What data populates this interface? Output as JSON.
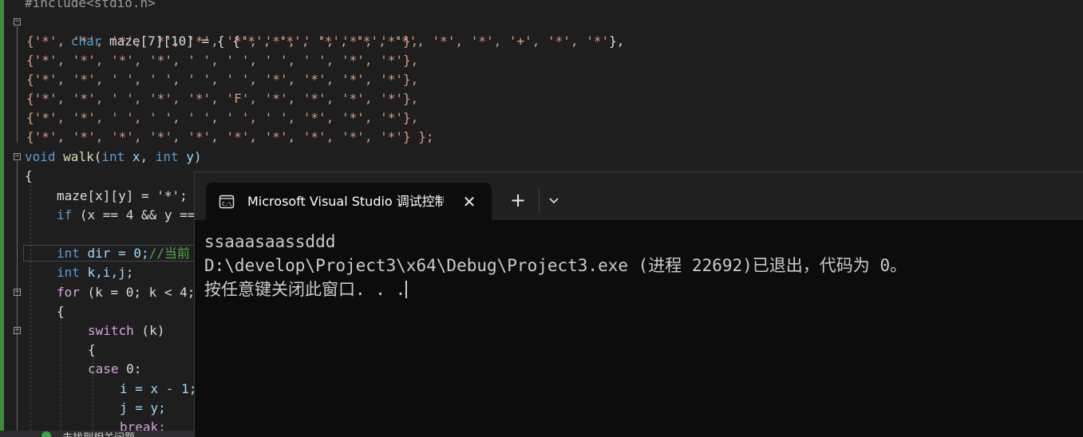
{
  "editor": {
    "include_line": "#include<stdio.h>",
    "maze_decl": "char maze[7][10] = { {'*', '*', '*', '*', '*', '*', '*', '+', '*', '*'},",
    "maze_rows": [
      "{'*', '*', '*', '*', '*', '*', '*', ' ', '*', '*'},",
      "{'*', '*', '*', '*', ' ', ' ', ' ', ' ', '*', '*'},",
      "{'*', '*', ' ', ' ', ' ', ' ', '*', '*', '*', '*'},",
      "{'*', '*', ' ', '*', '*', 'F', '*', '*', '*', '*'},",
      "{'*', '*', ' ', ' ', ' ', ' ', ' ', '*', '*', '*'},",
      "{'*', '*', '*', '*', '*', '*', '*', '*', '*', '*'} };"
    ],
    "walk_decl_kw": "void",
    "walk_decl_fn": "walk",
    "walk_decl_rest": "(",
    "walk_int1": "int",
    "walk_x": " x, ",
    "walk_int2": "int",
    "walk_y": " y)",
    "brace_open": "{",
    "maze_assign": "maze[x][y] = '*';",
    "if_kw": "if",
    "if_rest": " (x == 4 && y ==",
    "dir_kw": "int",
    "dir_rest": " dir = 0;",
    "dir_comment": "//当前",
    "kij_kw": "int",
    "kij_rest": " k,i,j;",
    "for_kw": "for",
    "for_rest": " (k = 0; k < 4;",
    "brace2": "{",
    "switch_kw": "switch",
    "switch_rest": " (k)",
    "brace3": "{",
    "case_kw": "case",
    "case_rest": " 0:",
    "i_assign": "i = x - 1;",
    "j_assign": "j = y;",
    "break_kw": "break;",
    "status_text": "未找到相关问题"
  },
  "terminal": {
    "tab_title": "Microsoft Visual Studio 调试控制台",
    "tab_icon": "console-icon",
    "close_glyph": "✕",
    "new_tab_glyph": "+",
    "dropdown_icon": "chevron-down-icon",
    "output_lines": [
      "ssaaasaassddd",
      "D:\\develop\\Project3\\x64\\Debug\\Project3.exe (进程 22692)已退出，代码为 0。",
      "按任意键关闭此窗口. . ."
    ]
  },
  "colors": {
    "editor_bg": "#1e1e1e",
    "terminal_bg": "#0c0c0c",
    "tabbar_bg": "#202020",
    "keyword": "#569cd6",
    "string": "#d69d85",
    "change_bar": "#3b8f3b"
  }
}
